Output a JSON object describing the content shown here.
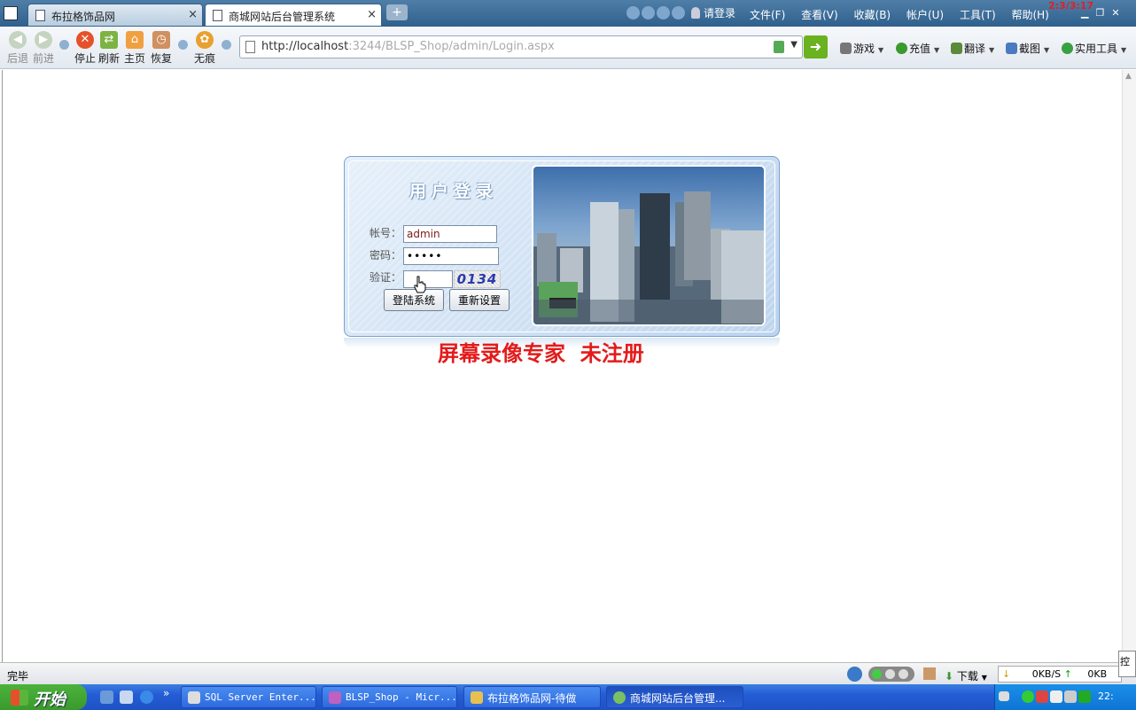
{
  "browser": {
    "tabs": [
      {
        "label": "布拉格饰品网",
        "close": "×"
      },
      {
        "label": "商城网站后台管理系统",
        "close": "×"
      }
    ],
    "new_tab": "+",
    "login_link": "请登录",
    "menu": [
      "文件(F)",
      "查看(V)",
      "收藏(B)",
      "帐户(U)",
      "工具(T)",
      "帮助(H)"
    ],
    "overlay_counter": "2:3/3:17"
  },
  "toolbar": {
    "back": "后退",
    "forward": "前进",
    "stop": "停止",
    "refresh": "刷新",
    "home": "主页",
    "restore": "恢复",
    "incognito": "无痕",
    "address_host": "http://localhost",
    "address_rest": ":3244/BLSP_Shop/admin/Login.aspx",
    "right_tools": [
      "游戏",
      "充值",
      "翻译",
      "截图",
      "实用工具"
    ]
  },
  "login": {
    "title": "用户登录",
    "account_label": "帐号：",
    "account_value": "admin",
    "password_label": "密码：",
    "password_value": "•••••",
    "captcha_label": "验证：",
    "captcha_value": "",
    "captcha_code": "0134",
    "login_button": "登陆系统",
    "reset_button": "重新设置"
  },
  "watermark": "屏幕录像专家  未注册",
  "status": {
    "text": "完毕",
    "download": "下载",
    "down_speed": "0KB/S",
    "up_speed": "0KB"
  },
  "ctrl_box": "控",
  "taskbar": {
    "start": "开始",
    "quick_more": "»",
    "tasks": [
      "SQL Server Enter...",
      "BLSP_Shop - Micr...",
      "布拉格饰品网-待做",
      "商城网站后台管理..."
    ],
    "clock": "22:"
  },
  "colors": {
    "watermark": "#e31b1b",
    "captcha_text": "#2a3bb0",
    "taskbar": "#245dd6",
    "start_button": "#3a9a2d"
  }
}
